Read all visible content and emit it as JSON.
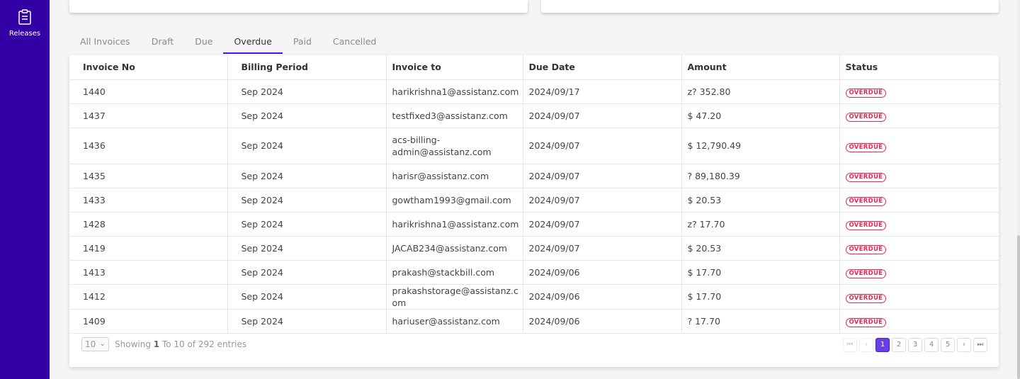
{
  "sidebar": {
    "releases_label": "Releases",
    "releases_icon": "clipboard-icon"
  },
  "tabs": [
    "All Invoices",
    "Draft",
    "Due",
    "Overdue",
    "Paid",
    "Cancelled"
  ],
  "active_tab": "Overdue",
  "table": {
    "headers": [
      "Invoice No",
      "Billing Period",
      "Invoice to",
      "Due Date",
      "Amount",
      "Status"
    ],
    "rows": [
      [
        "1440",
        "Sep 2024",
        "harikrishna1@assistanz.com",
        "2024/09/17",
        "z? 352.80",
        "OVERDUE"
      ],
      [
        "1437",
        "Sep 2024",
        "testfixed3@assistanz.com",
        "2024/09/07",
        "$ 47.20",
        "OVERDUE"
      ],
      [
        "1436",
        "Sep 2024",
        "acs-billing-admin@assistanz.com",
        "2024/09/07",
        "$ 12,790.49",
        "OVERDUE"
      ],
      [
        "1435",
        "Sep 2024",
        "harisr@assistanz.com",
        "2024/09/07",
        "? 89,180.39",
        "OVERDUE"
      ],
      [
        "1433",
        "Sep 2024",
        "gowtham1993@gmail.com",
        "2024/09/07",
        "$ 20.53",
        "OVERDUE"
      ],
      [
        "1428",
        "Sep 2024",
        "harikrishna1@assistanz.com",
        "2024/09/07",
        "z? 17.70",
        "OVERDUE"
      ],
      [
        "1419",
        "Sep 2024",
        "JACAB234@assistanz.com",
        "2024/09/07",
        "$ 20.53",
        "OVERDUE"
      ],
      [
        "1413",
        "Sep 2024",
        "prakash@stackbill.com",
        "2024/09/06",
        "$ 17.70",
        "OVERDUE"
      ],
      [
        "1412",
        "Sep 2024",
        "prakashstorage@assistanz.com",
        "2024/09/06",
        "$ 17.70",
        "OVERDUE"
      ],
      [
        "1409",
        "Sep 2024",
        "hariuser@assistanz.com",
        "2024/09/06",
        "? 17.70",
        "OVERDUE"
      ]
    ]
  },
  "footer": {
    "page_size": "10",
    "showing_prefix": "Showing ",
    "showing_from": "1",
    "showing_suffix": " To 10 of 292 entries",
    "pages": [
      "1",
      "2",
      "3",
      "4",
      "5"
    ],
    "current_page": "1",
    "first_glyph": "⏮",
    "prev_glyph": "‹",
    "next_glyph": "›",
    "last_glyph": "⏭"
  },
  "colors": {
    "sidebar": "#3300a6",
    "accent": "#4a1bd0",
    "overdue": "#e02a55"
  }
}
